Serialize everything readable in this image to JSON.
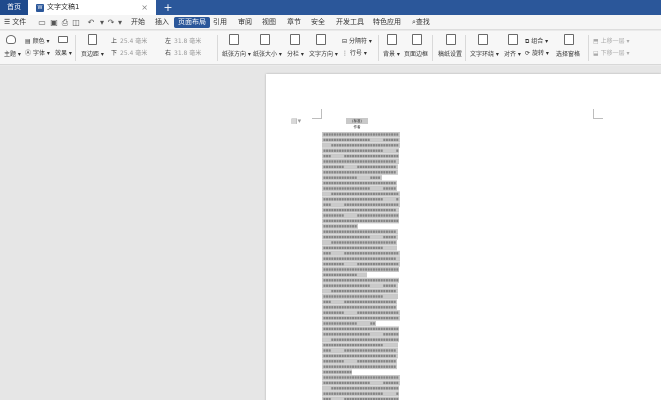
{
  "tabs": {
    "home": "首页",
    "doc_title": "文字文稿1",
    "doc_icon": "W",
    "close": "×",
    "new_tab": "+"
  },
  "menu": {
    "file": "文件",
    "items": [
      "开始",
      "插入",
      "页面布局",
      "引用",
      "审阅",
      "视图",
      "章节",
      "安全",
      "开发工具",
      "特色应用"
    ],
    "active_index": 2,
    "search": "查找"
  },
  "ribbon": {
    "theme": "主题",
    "color": "颜色",
    "font": "字体",
    "effect": "效果",
    "margin": "页边距",
    "top_label": "上",
    "top_value": "25.4 毫米",
    "bottom_label": "下",
    "bottom_value": "25.4 毫米",
    "left_label": "左",
    "left_value": "31.8 毫米",
    "right_label": "右",
    "right_value": "31.8 毫米",
    "orientation": "纸张方向",
    "size": "纸张大小",
    "columns": "分栏",
    "text_direction": "文字方向",
    "separator": "分隔符",
    "line_number": "行号",
    "background": "背景",
    "page_border": "页面边框",
    "paper_setting": "稿纸设置",
    "wrap": "文字环绕",
    "align": "对齐",
    "group": "组合",
    "rotate": "旋转",
    "select_pane": "选择窗格",
    "bring_up": "上移一层",
    "send_down": "下移一层"
  },
  "document": {
    "title": "(标准)",
    "subtitle": "作者"
  },
  "colors": {
    "accent": "#2b579a",
    "selection": "#c9c9c9"
  }
}
